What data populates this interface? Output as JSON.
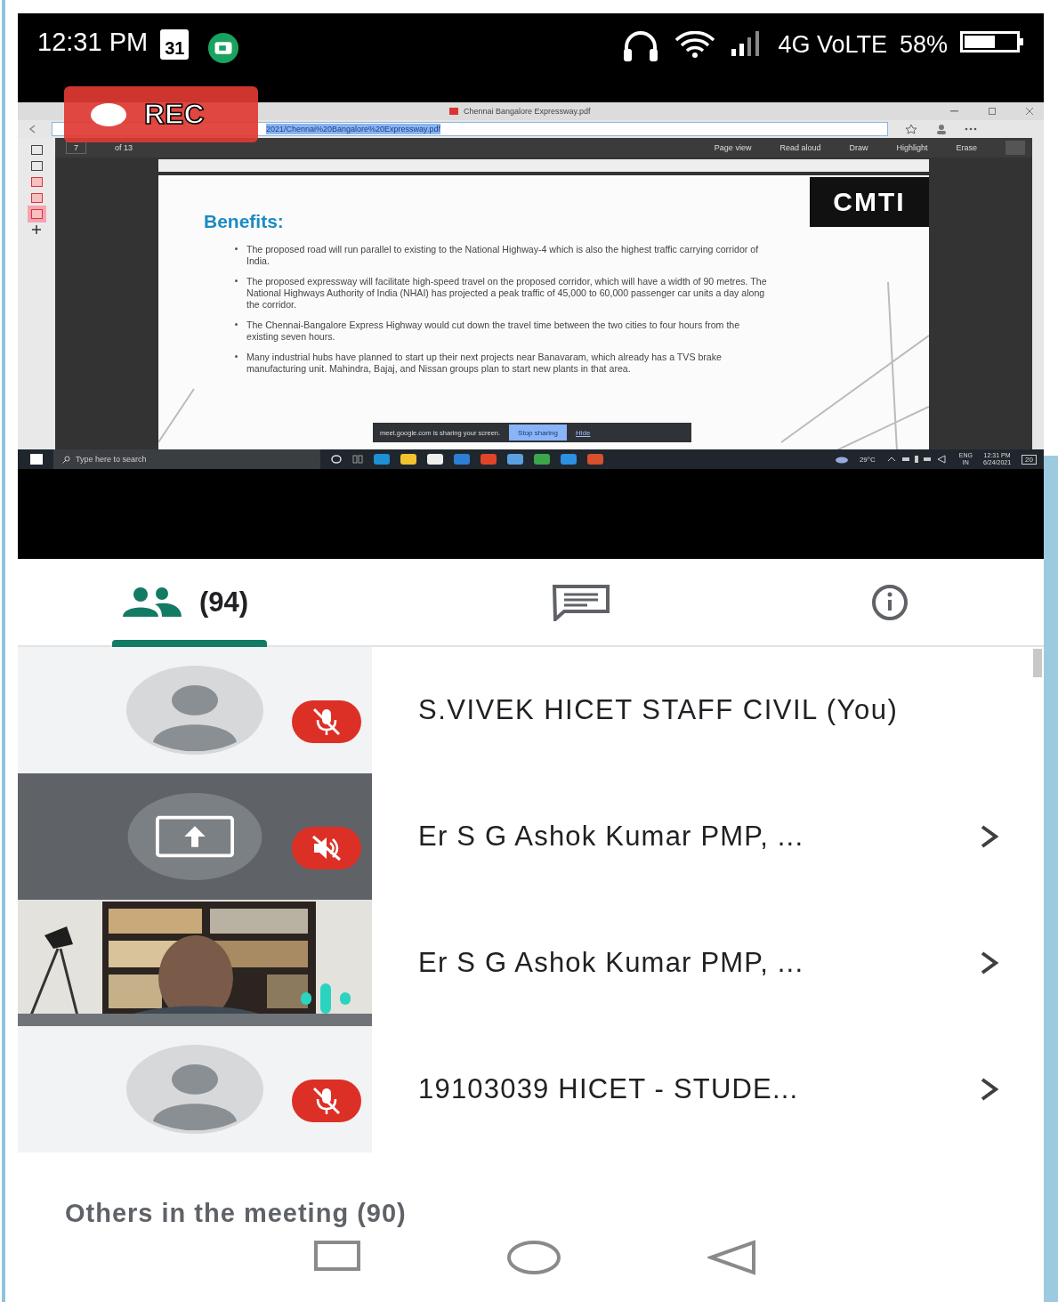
{
  "status_bar": {
    "time": "12:31 PM",
    "calendar_day": "31",
    "network": "4G VoLTE",
    "battery": "58%"
  },
  "recording": {
    "on": true,
    "label": "REC"
  },
  "shared_screen": {
    "browser": {
      "tab_title": "Chennai Bangalore Expressway.pdf",
      "address": "2021/Chennai%20Bangalore%20Expressway.pdf"
    },
    "pdf_toolbar": {
      "page": "7",
      "page_count": "of 13",
      "items": [
        "Page view",
        "Read aloud",
        "Draw",
        "Highlight",
        "Erase"
      ]
    },
    "slide": {
      "title": "Benefits:",
      "logo": "CMTI",
      "bullets": [
        "The proposed road will run parallel to existing to the National Highway-4 which is also the highest traffic carrying corridor of India.",
        "The proposed expressway will facilitate high-speed travel on the proposed corridor, which will have a width of 90 metres. The National Highways Authority of India (NHAI) has projected a peak traffic of 45,000 to 60,000 passenger car units a day along the corridor.",
        "The Chennai-Bangalore Express Highway would cut down the travel time between the two cities to four hours from the existing seven hours.",
        "Many industrial hubs have planned to start up their next projects near Banavaram, which already has a TVS brake manufacturing unit. Mahindra, Bajaj, and Nissan groups plan to start new plants in that area."
      ]
    },
    "share_bar": {
      "message": "meet.google.com is sharing your screen.",
      "stop_button": "Stop sharing",
      "hide_link": "Hide"
    },
    "taskbar": {
      "search_placeholder": "Type here to search",
      "weather": "29°C",
      "language": "ENG",
      "region": "IN",
      "time": "12:31 PM",
      "date": "6/24/2021",
      "notifications": "20"
    }
  },
  "tabs": [
    {
      "kind": "people",
      "count": "(94)",
      "selected": true
    },
    {
      "kind": "chat",
      "selected": false
    },
    {
      "kind": "info",
      "selected": false
    }
  ],
  "participants": [
    {
      "kind": "avatar",
      "name": "S.VIVEK HICET STAFF CIVIL (You)",
      "muted": true,
      "speaking": false,
      "has_details": false
    },
    {
      "kind": "presenting",
      "name": "Er S G Ashok Kumar PMP, ...",
      "muted": true,
      "speaking": false,
      "has_details": true
    },
    {
      "kind": "video",
      "name": "Er S G Ashok Kumar PMP, ...",
      "muted": false,
      "speaking": true,
      "has_details": true
    },
    {
      "kind": "avatar",
      "name": "19103039 HICET - STUDE...",
      "muted": true,
      "speaking": false,
      "has_details": true
    }
  ],
  "others": {
    "label": "Others in the meeting (90)"
  }
}
